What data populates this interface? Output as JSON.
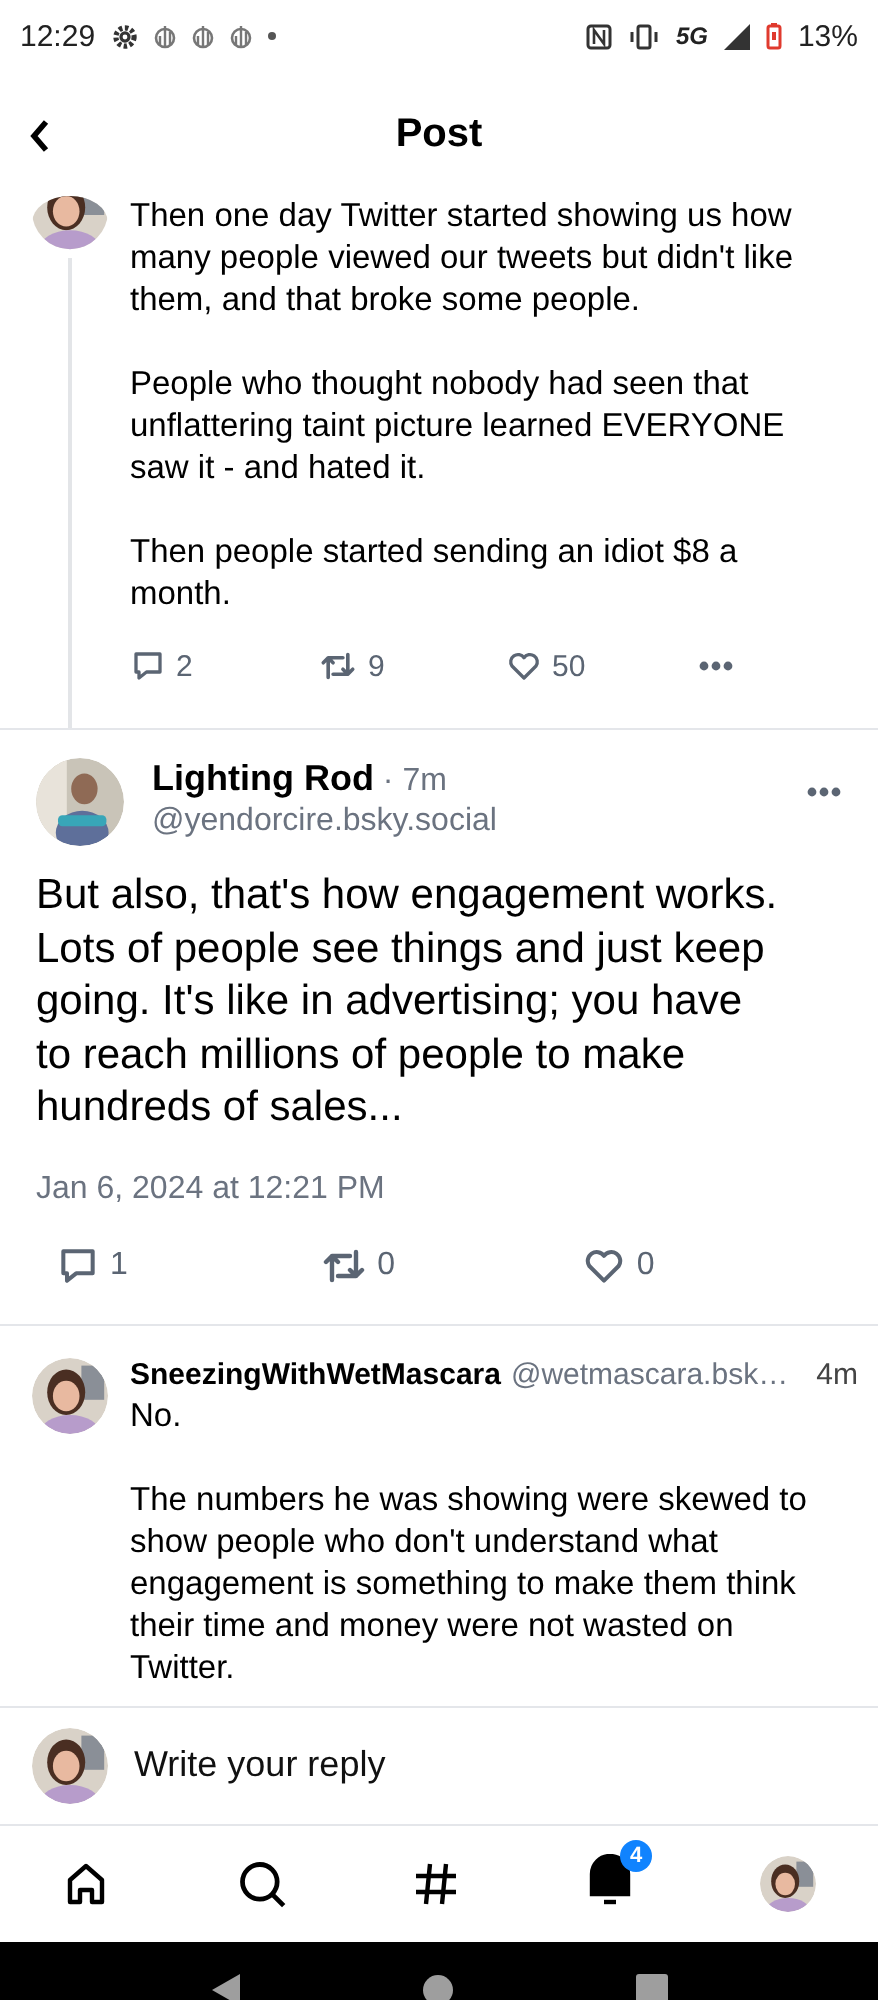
{
  "status_bar": {
    "time": "12:29",
    "network": "5G",
    "battery": "13%"
  },
  "header": {
    "title": "Post"
  },
  "parent_post": {
    "paragraphs": [
      "Then one day Twitter started showing us how many people viewed our tweets but didn't like them, and that broke some people.",
      "People who thought nobody had seen that unflattering taint picture learned EVERYONE saw it - and hated it.",
      "Then people started sending an idiot $8 a month."
    ],
    "replies": "2",
    "reposts": "9",
    "likes": "50"
  },
  "main_post": {
    "author": "Lighting Rod",
    "time": "· 7m",
    "handle": "@yendorcire.bsky.social",
    "text": "But also, that's how engagement works. Lots of people see things and just keep going. It's like in advertising; you have to reach millions of people to make hundreds of sales...",
    "timestamp": "Jan 6, 2024 at 12:21 PM",
    "replies": "1",
    "reposts": "0",
    "likes": "0"
  },
  "reply": {
    "author": "SneezingWithWetMascara",
    "handle": "@wetmascara.bsk…",
    "time": "4m",
    "paragraphs": [
      "No.",
      "The numbers he was showing were skewed to show people who don't understand what engagement is something to make them think their time and money were not wasted on Twitter."
    ]
  },
  "composer": {
    "placeholder": "Write your reply"
  },
  "nav": [
    {
      "kind": "home",
      "selected": false
    },
    {
      "kind": "search",
      "selected": false
    },
    {
      "kind": "feeds",
      "selected": false
    },
    {
      "kind": "notifications",
      "selected": true,
      "badge": "4"
    },
    {
      "kind": "profile",
      "selected": false
    }
  ]
}
